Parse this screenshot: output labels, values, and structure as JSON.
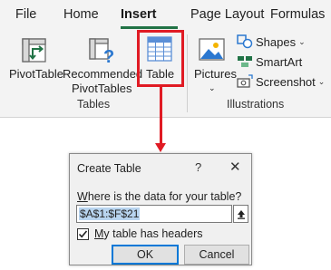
{
  "ribbon": {
    "tabs": [
      {
        "label": "File"
      },
      {
        "label": "Home"
      },
      {
        "label": "Insert"
      },
      {
        "label": "Page Layout"
      },
      {
        "label": "Formulas"
      }
    ],
    "active_tab": "Insert",
    "tables_group": {
      "label": "Tables",
      "pivottable": "PivotTable",
      "recommended_line1": "Recommended",
      "recommended_line2": "PivotTables",
      "table": "Table"
    },
    "illustrations_group": {
      "label": "Illustrations",
      "pictures": "Pictures",
      "shapes": "Shapes",
      "smartart": "SmartArt",
      "screenshot": "Screenshot"
    }
  },
  "annotation": {
    "highlight_color": "#e01b24"
  },
  "dialog": {
    "title": "Create Table",
    "help": "?",
    "close": "✕",
    "prompt_prefix": "W",
    "prompt_rest": "here is the data for your table?",
    "range_value": "$A$1:$F$21",
    "checkbox_checked": true,
    "checkbox_label_prefix": "M",
    "checkbox_label_rest": "y table has headers",
    "ok_label": "OK",
    "cancel_label": "Cancel"
  },
  "colors": {
    "accent": "#217346",
    "focus": "#0078d7"
  }
}
